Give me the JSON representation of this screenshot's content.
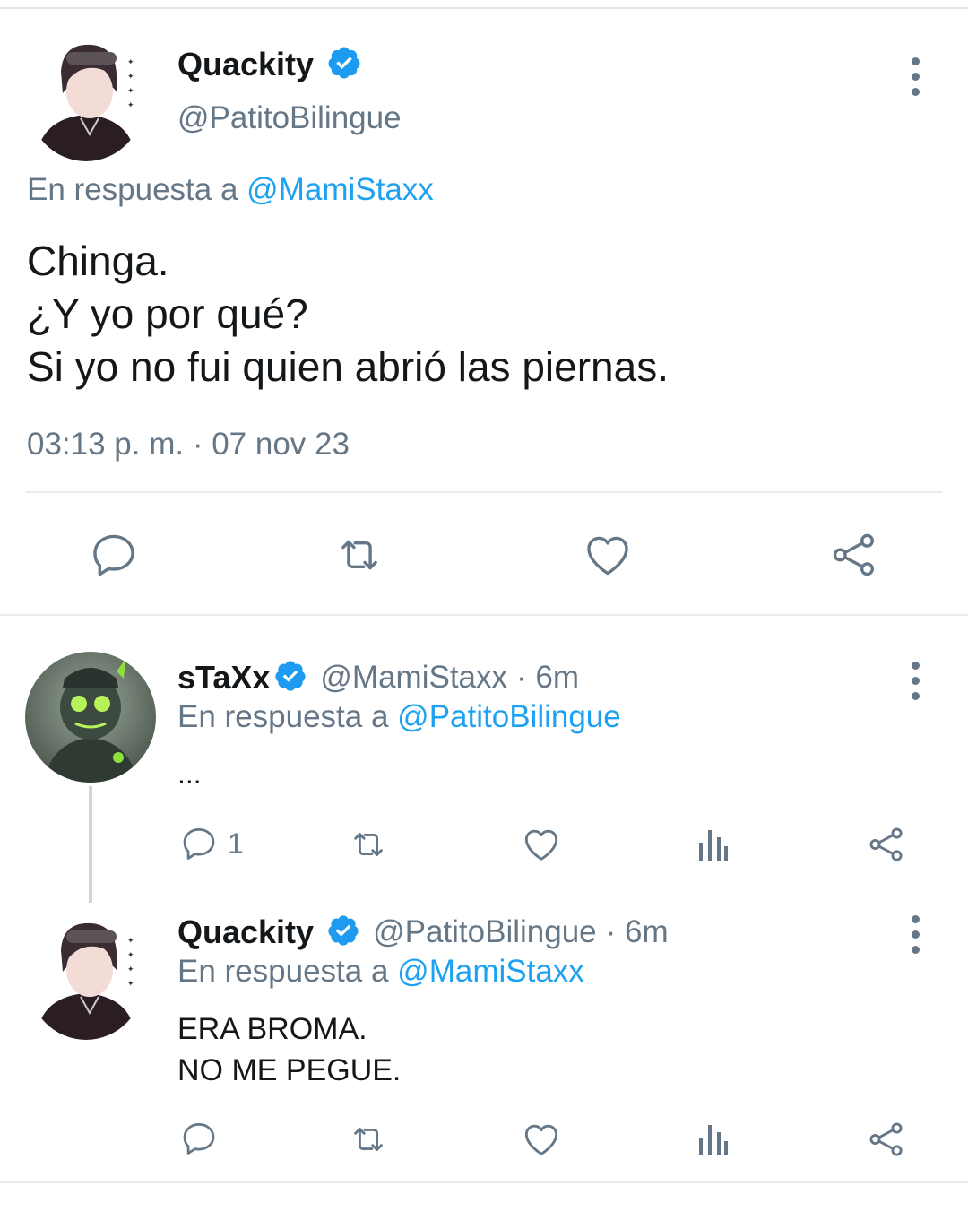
{
  "main_tweet": {
    "display_name": "Quackity",
    "handle": "@PatitoBilingue",
    "reply_prefix": "En respuesta a",
    "reply_to": "@MamiStaxx",
    "text": "Chinga.\n¿Y yo por qué?\nSi yo no fui quien abrió las piernas.",
    "timestamp": "03:13 p. m. · 07 nov 23"
  },
  "reply1": {
    "display_name": "sTaXx",
    "handle": "@MamiStaxx",
    "age": "· 6m",
    "reply_prefix": "En respuesta a",
    "reply_to": "@PatitoBilingue",
    "text": "...",
    "reply_count": "1"
  },
  "reply2": {
    "display_name": "Quackity",
    "handle": "@PatitoBilingue",
    "age": "· 6m",
    "reply_prefix": "En respuesta a",
    "reply_to": "@MamiStaxx",
    "text": "ERA BROMA.\nNO ME PEGUE."
  },
  "colors": {
    "link": "#1da1f2",
    "secondary_text": "#657786",
    "verified_badge": "#1d9bf0"
  },
  "icons": [
    "verified-icon",
    "more-icon",
    "reply-icon",
    "retweet-icon",
    "like-icon",
    "share-icon",
    "views-icon"
  ]
}
